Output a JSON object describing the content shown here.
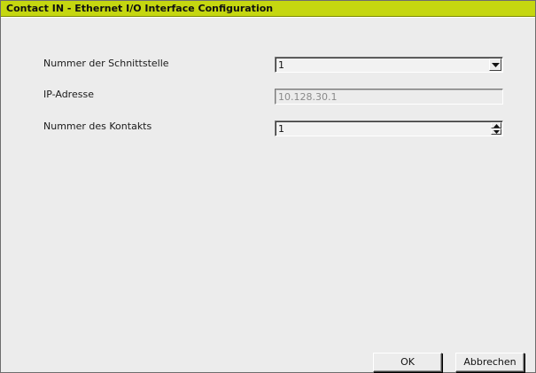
{
  "window": {
    "title": "Contact IN - Ethernet I/O Interface Configuration"
  },
  "form": {
    "interface_number": {
      "label": "Nummer der Schnittstelle",
      "value": "1"
    },
    "ip_address": {
      "label": "IP-Adresse",
      "value": "10.128.30.1"
    },
    "contact_number": {
      "label": "Nummer des Kontakts",
      "value": "1"
    }
  },
  "buttons": {
    "ok": "OK",
    "cancel": "Abbrechen"
  },
  "colors": {
    "titlebar": "#c5d710",
    "background": "#ececec"
  },
  "icons": {
    "dropdown": "chevron-down-icon",
    "spinner_up": "spin-up-icon",
    "spinner_down": "spin-down-icon"
  }
}
